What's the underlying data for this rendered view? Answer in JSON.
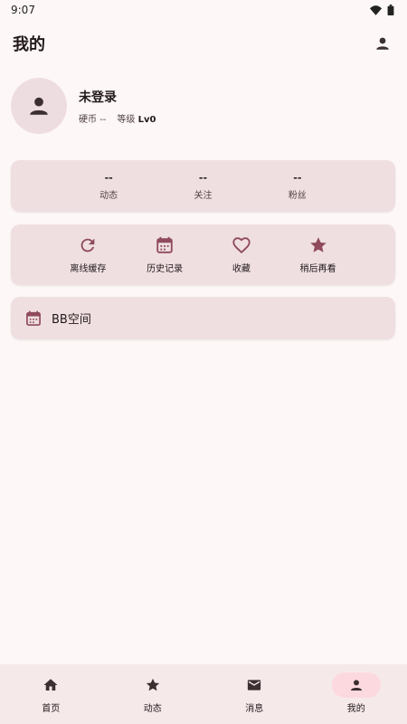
{
  "status_bar": {
    "time": "9:07",
    "icons": [
      "wifi-icon",
      "battery-icon"
    ]
  },
  "header": {
    "title": "我的",
    "action_icon": "person-icon"
  },
  "profile": {
    "name": "未登录",
    "coins_label": "硬币",
    "coins_value": "--",
    "level_label": "等级",
    "level_value": "Lv0"
  },
  "stats": [
    {
      "value": "--",
      "label": "动态"
    },
    {
      "value": "--",
      "label": "关注"
    },
    {
      "value": "--",
      "label": "粉丝"
    }
  ],
  "actions": [
    {
      "icon": "refresh-icon",
      "label": "离线缓存"
    },
    {
      "icon": "calendar-icon",
      "label": "历史记录"
    },
    {
      "icon": "heart-icon",
      "label": "收藏"
    },
    {
      "icon": "star-icon",
      "label": "稍后再看"
    }
  ],
  "space": {
    "icon": "calendar-icon",
    "label": "BB空间"
  },
  "bottom_nav": [
    {
      "icon": "home-icon",
      "label": "首页",
      "active": false
    },
    {
      "icon": "star-icon",
      "label": "动态",
      "active": false
    },
    {
      "icon": "mail-icon",
      "label": "消息",
      "active": false
    },
    {
      "icon": "person-icon",
      "label": "我的",
      "active": true
    }
  ],
  "colors": {
    "accent": "#8f4a5b",
    "background": "#fdf7f7",
    "card": "#efdfe1",
    "nav_active": "#fcd9df"
  }
}
